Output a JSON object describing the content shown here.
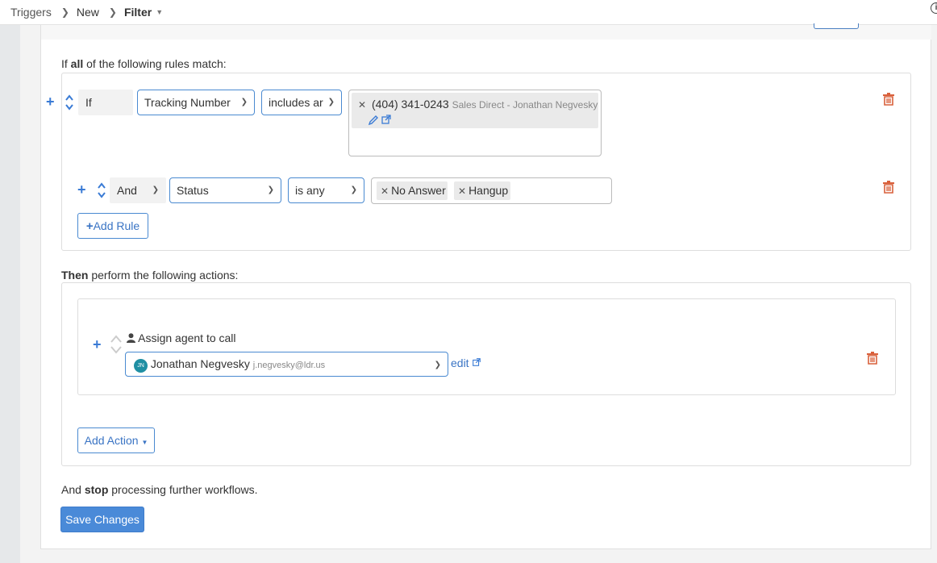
{
  "breadcrumb": {
    "items": [
      "Triggers",
      "New",
      "Filter"
    ]
  },
  "conditions": {
    "heading_prefix": "If",
    "heading_bold": "all",
    "heading_suffix": "of the following rules match:",
    "rules": [
      {
        "connector": "If",
        "field": "Tracking Number",
        "operator": "includes ar",
        "values": [
          {
            "number": "(404) 341-0243",
            "desc": "Sales Direct - Jonathan Negvesky"
          }
        ]
      },
      {
        "connector": "And",
        "field": "Status",
        "operator": "is any",
        "values": [
          "No Answer",
          "Hangup"
        ]
      }
    ],
    "add_rule_label": "Add Rule"
  },
  "actions": {
    "heading_bold": "Then",
    "heading_suffix": "perform the following actions:",
    "items": [
      {
        "label": "Assign agent to call",
        "agent_initials": "JN",
        "agent_name": "Jonathan Negvesky",
        "agent_email": "j.negvesky@ldr.us",
        "edit_label": "edit"
      }
    ],
    "add_action_label": "Add Action"
  },
  "footer": {
    "stop_prefix": "And",
    "stop_bold": "stop",
    "stop_suffix": "processing further workflows.",
    "save_label": "Save Changes"
  },
  "colors": {
    "accent": "#4a8ad8",
    "trash": "#d9603b"
  }
}
